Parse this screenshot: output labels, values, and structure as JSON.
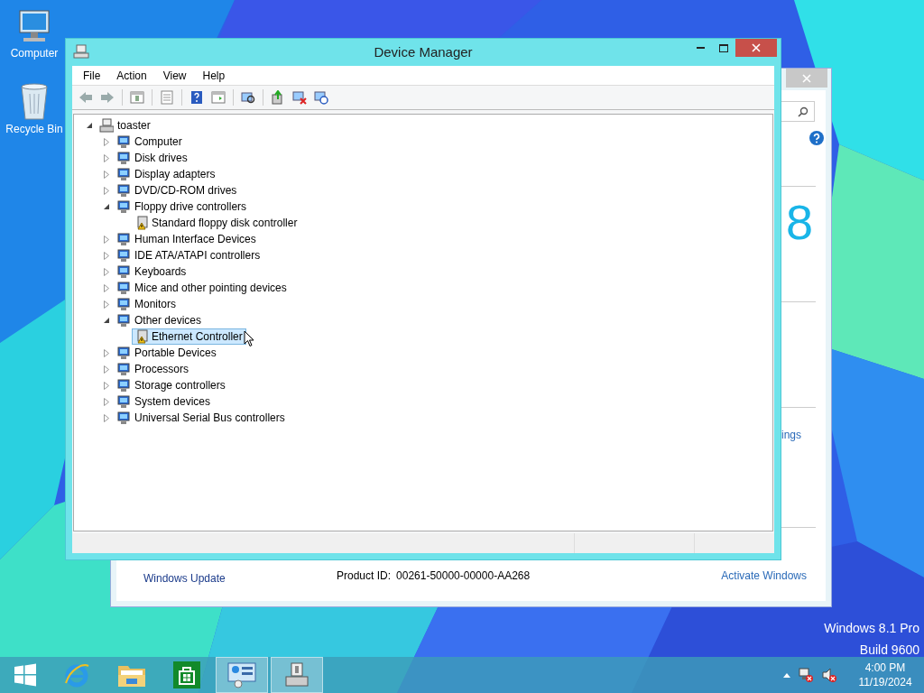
{
  "desktop_icons": [
    {
      "label": "Computer"
    },
    {
      "label": "Recycle Bin"
    }
  ],
  "background_window": {
    "big_glyph": "8",
    "link_fragment": "ings",
    "footer_link": "Windows Update",
    "product_id_label": "Product ID:",
    "product_id": "00261-50000-00000-AA268",
    "activate_link": "Activate Windows"
  },
  "window": {
    "title": "Device Manager"
  },
  "menu": [
    "File",
    "Action",
    "View",
    "Help"
  ],
  "tree": {
    "label": "toaster",
    "expanded": true,
    "selected": false,
    "children": [
      {
        "label": "Computer",
        "expanded": false,
        "selected": false
      },
      {
        "label": "Disk drives",
        "expanded": false,
        "selected": false
      },
      {
        "label": "Display adapters",
        "expanded": false,
        "selected": false
      },
      {
        "label": "DVD/CD-ROM drives",
        "expanded": false,
        "selected": false
      },
      {
        "label": "Floppy drive controllers",
        "expanded": true,
        "selected": false,
        "children": [
          {
            "label": "Standard floppy disk controller",
            "warning": true,
            "selected": false
          }
        ]
      },
      {
        "label": "Human Interface Devices",
        "expanded": false,
        "selected": false
      },
      {
        "label": "IDE ATA/ATAPI controllers",
        "expanded": false,
        "selected": false
      },
      {
        "label": "Keyboards",
        "expanded": false,
        "selected": false
      },
      {
        "label": "Mice and other pointing devices",
        "expanded": false,
        "selected": false
      },
      {
        "label": "Monitors",
        "expanded": false,
        "selected": false
      },
      {
        "label": "Other devices",
        "expanded": true,
        "selected": false,
        "children": [
          {
            "label": "Ethernet Controller",
            "warning": true,
            "selected": true
          }
        ]
      },
      {
        "label": "Portable Devices",
        "expanded": false,
        "selected": false
      },
      {
        "label": "Processors",
        "expanded": false,
        "selected": false
      },
      {
        "label": "Storage controllers",
        "expanded": false,
        "selected": false
      },
      {
        "label": "System devices",
        "expanded": false,
        "selected": false
      },
      {
        "label": "Universal Serial Bus controllers",
        "expanded": false,
        "selected": false
      }
    ]
  },
  "os_watermark": [
    "Windows 8.1 Pro",
    "Build 9600"
  ],
  "taskbar": {
    "apps": [
      {
        "active": false
      },
      {
        "active": false
      },
      {
        "active": false
      },
      {
        "active": false
      },
      {
        "active": true
      },
      {
        "active": true
      }
    ],
    "clock": {
      "time": "4:00 PM",
      "date": "11/19/2024"
    }
  }
}
